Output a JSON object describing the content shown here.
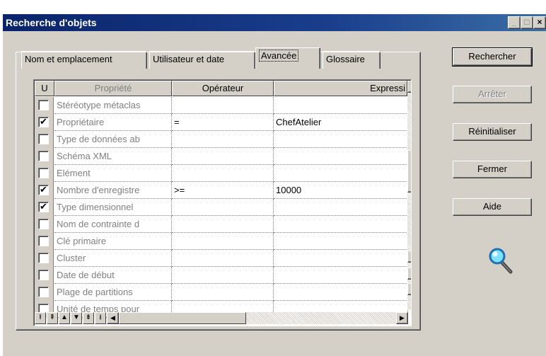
{
  "window": {
    "title": "Recherche d'objets",
    "controls": {
      "minimize": "_",
      "maximize": "□",
      "close": "×"
    }
  },
  "tabs": [
    {
      "label": "Nom et emplacement",
      "active": false
    },
    {
      "label": "Utilisateur et date",
      "active": false
    },
    {
      "label": "Avancée",
      "active": true
    },
    {
      "label": "Glossaire",
      "active": false
    }
  ],
  "grid": {
    "columns": [
      "U",
      "Propriété",
      "Opérateur",
      "Expressi"
    ],
    "rows": [
      {
        "checked": false,
        "property": "Stéréotype métaclas",
        "operator": "",
        "expression": ""
      },
      {
        "checked": true,
        "property": "Propriétaire",
        "operator": "=",
        "expression": "ChefAtelier"
      },
      {
        "checked": false,
        "property": "Type de données ab",
        "operator": "",
        "expression": ""
      },
      {
        "checked": false,
        "property": "Schéma XML",
        "operator": "",
        "expression": ""
      },
      {
        "checked": false,
        "property": "Elément",
        "operator": "",
        "expression": ""
      },
      {
        "checked": true,
        "property": "Nombre d'enregistre",
        "operator": ">=",
        "expression": "10000"
      },
      {
        "checked": true,
        "property": "Type dimensionnel",
        "operator": "",
        "expression": ""
      },
      {
        "checked": false,
        "property": "Nom de contrainte d",
        "operator": "",
        "expression": ""
      },
      {
        "checked": false,
        "property": "Clé primaire",
        "operator": "",
        "expression": ""
      },
      {
        "checked": false,
        "property": "Cluster",
        "operator": "",
        "expression": ""
      },
      {
        "checked": false,
        "property": "Date de début",
        "operator": "",
        "expression": ""
      },
      {
        "checked": false,
        "property": "Plage de partitions",
        "operator": "",
        "expression": ""
      },
      {
        "checked": false,
        "property": "Unité de temps pour",
        "operator": "",
        "expression": ""
      }
    ],
    "check_mark": "✔",
    "nav_buttons": [
      "⭱",
      "⇞",
      "▲",
      "▼",
      "⇟",
      "⭳"
    ]
  },
  "buttons": {
    "search": "Rechercher",
    "stop": "Arrêter",
    "reset": "Réinitialiser",
    "close": "Fermer",
    "help": "Aide"
  },
  "icons": {
    "search": "magnifier-icon"
  }
}
